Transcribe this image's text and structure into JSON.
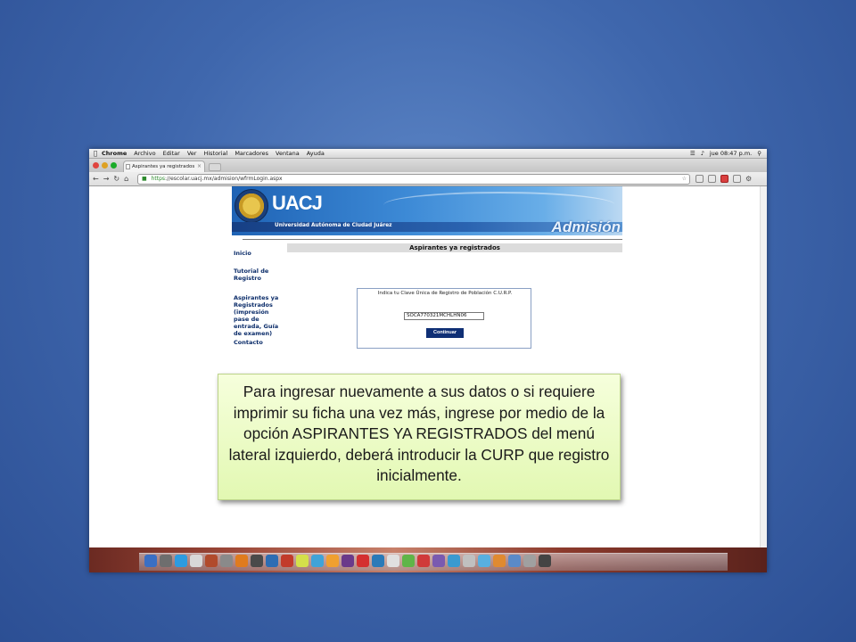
{
  "menubar": {
    "app": "Chrome",
    "items": [
      "Archivo",
      "Editar",
      "Ver",
      "Historial",
      "Marcadores",
      "Ventana",
      "Ayuda"
    ],
    "clock": "jue 08:47 p.m."
  },
  "tab": {
    "title": "Aspirantes ya registrados"
  },
  "address": {
    "scheme": "https",
    "rest": "://escolar.uacj.mx/admision/wfrmLogin.aspx"
  },
  "banner": {
    "logo": "UACJ",
    "university": "Universidad Autónoma de Ciudad Juárez",
    "section": "Admisión"
  },
  "nav": {
    "inicio": "Inicio",
    "tutorial": "Tutorial de Registro",
    "aspirantes": "Aspirantes ya Registrados (impresión pase de entrada, Guía de examen)",
    "contacto": "Contacto"
  },
  "main": {
    "heading": "Aspirantes ya registrados",
    "curp_prompt": "Indica tu Clave Única de Registro de Población C.U.R.P.",
    "curp_value": "SOCA770321MCHLHN06",
    "button": "Continuar"
  },
  "callout": {
    "text": "Para ingresar nuevamente a sus datos o si requiere imprimir su ficha una vez más, ingrese por medio de la opción ASPIRANTES YA REGISTRADOS del menú lateral izquierdo, deberá introducir la CURP que registro inicialmente."
  },
  "colors": {
    "background": "#3f67ad",
    "uacj_blue": "#1f63b5",
    "nav_link": "#0c2d6a",
    "button": "#0f2f75",
    "callout_bg": "#e2f8b2"
  }
}
